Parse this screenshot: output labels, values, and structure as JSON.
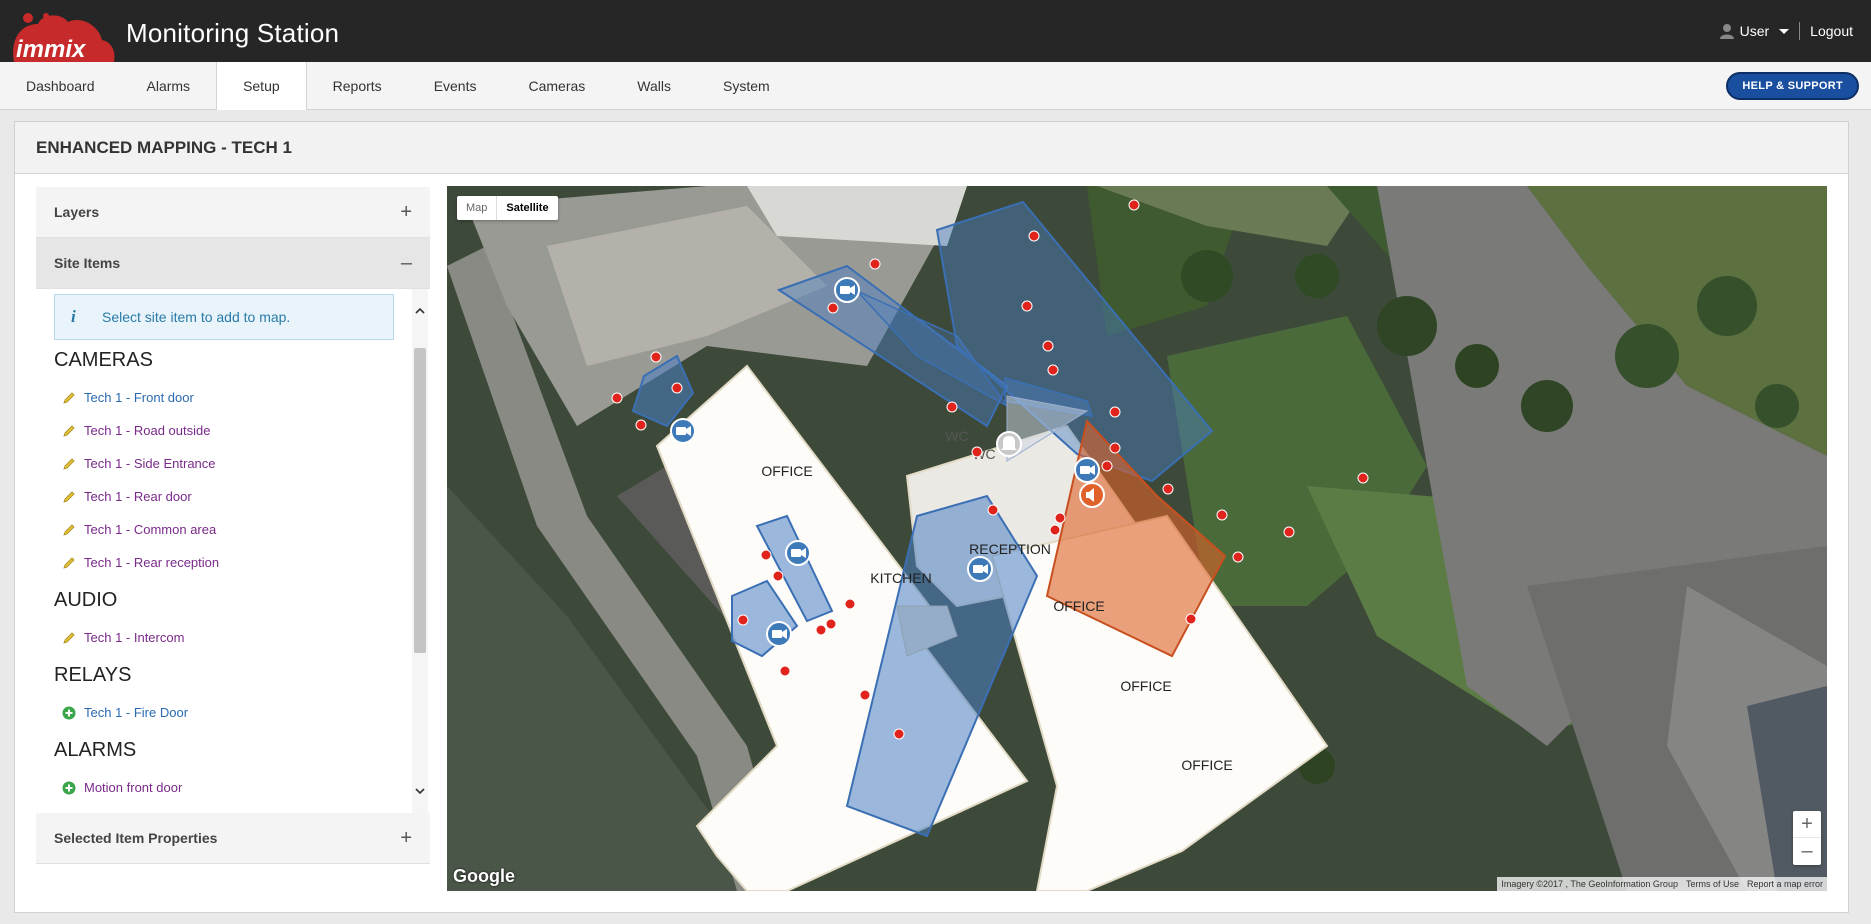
{
  "app": {
    "logo_text": "immix",
    "title": "Monitoring Station"
  },
  "user": {
    "name": "User",
    "logout": "Logout"
  },
  "nav": {
    "tabs": [
      {
        "label": "Dashboard"
      },
      {
        "label": "Alarms"
      },
      {
        "label": "Setup"
      },
      {
        "label": "Reports"
      },
      {
        "label": "Events"
      },
      {
        "label": "Cameras"
      },
      {
        "label": "Walls"
      },
      {
        "label": "System"
      }
    ],
    "active": "Setup",
    "help_label": "HELP & SUPPORT"
  },
  "panel": {
    "title": "ENHANCED MAPPING - TECH 1"
  },
  "sidebar": {
    "layers_label": "Layers",
    "site_items_label": "Site Items",
    "info_text": "Select site item to add to map.",
    "cameras_title": "CAMERAS",
    "cameras": [
      {
        "label": "Tech 1 - Front door"
      },
      {
        "label": "Tech 1 - Road outside"
      },
      {
        "label": "Tech 1 - Side Entrance"
      },
      {
        "label": "Tech 1 - Rear door"
      },
      {
        "label": "Tech 1 - Common area"
      },
      {
        "label": "Tech 1 - Rear reception"
      }
    ],
    "audio_title": "AUDIO",
    "audio": [
      {
        "label": "Tech 1 - Intercom"
      }
    ],
    "relays_title": "RELAYS",
    "relays": [
      {
        "label": "Tech 1 - Fire Door"
      }
    ],
    "alarms_title": "ALARMS",
    "alarms": [
      {
        "label": "Motion front door"
      }
    ],
    "selected_props_label": "Selected Item Properties"
  },
  "map": {
    "type_map": "Map",
    "type_satellite": "Satellite",
    "rooms": {
      "office1": "OFFICE",
      "kitchen": "KITCHEN",
      "reception": "RECEPTION",
      "office2": "OFFICE",
      "office3": "OFFICE",
      "office4": "OFFICE",
      "wc1": "WC",
      "wc2": "WC"
    },
    "google": "Google",
    "attribution": {
      "imagery": "Imagery ©2017 , The GeoInformation Group",
      "terms": "Terms of Use",
      "report": "Report a map error"
    }
  },
  "colors": {
    "topbar": "#262626",
    "help_button": "#1a4fa0",
    "camera_zone": "#4a7fc4",
    "audio_zone": "#e0622a",
    "marker": "#e0241c"
  }
}
